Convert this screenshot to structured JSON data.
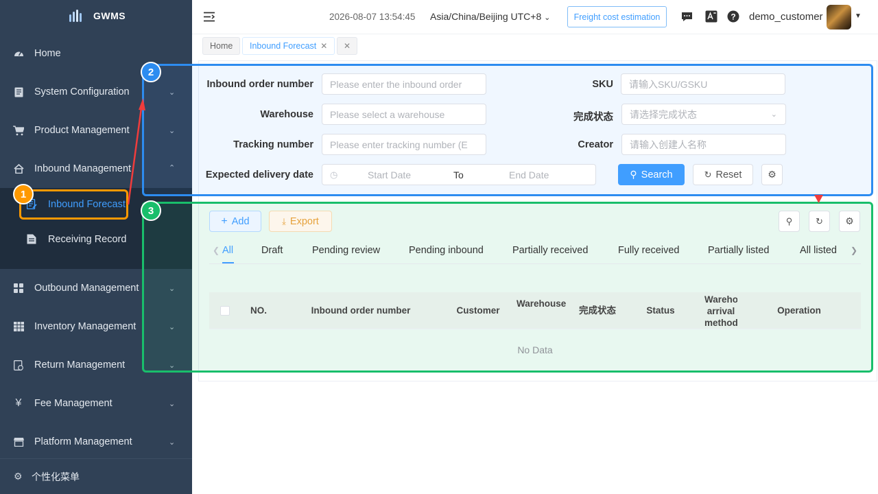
{
  "app": {
    "logo_text": "GWMS"
  },
  "sidebar": {
    "items": [
      {
        "label": "Home",
        "icon": "dashboard-icon"
      },
      {
        "label": "System Configuration",
        "icon": "document-icon"
      },
      {
        "label": "Product Management",
        "icon": "cart-icon"
      },
      {
        "label": "Inbound Management",
        "icon": "home-icon"
      },
      {
        "label": "Outbound Management",
        "icon": "grid-icon"
      },
      {
        "label": "Inventory Management",
        "icon": "table-icon"
      },
      {
        "label": "Return Management",
        "icon": "return-icon"
      },
      {
        "label": "Fee Management",
        "icon": "yen-icon"
      },
      {
        "label": "Platform Management",
        "icon": "store-icon"
      }
    ],
    "submenu": [
      {
        "label": "Inbound Forecast",
        "active": true
      },
      {
        "label": "Receiving Record",
        "active": false
      }
    ],
    "footer": "个性化菜单"
  },
  "topbar": {
    "datetime": "2026-08-07 13:54:45",
    "timezone": "Asia/China/Beijing UTC+8",
    "freight_button": "Freight cost estimation",
    "username": "demo_customer"
  },
  "tabs": [
    {
      "label": "Home"
    },
    {
      "label": "Inbound Forecast",
      "active": true
    }
  ],
  "filters": {
    "order_label": "Inbound order number",
    "order_placeholder": "Please enter the inbound order",
    "sku_label": "SKU",
    "sku_placeholder": "请输入SKU/GSKU",
    "warehouse_label": "Warehouse",
    "warehouse_placeholder": "Please select a warehouse",
    "status_label": "完成状态",
    "status_placeholder": "请选择完成状态",
    "tracking_label": "Tracking number",
    "tracking_placeholder": "Please enter tracking number (E",
    "creator_label": "Creator",
    "creator_placeholder": "请输入创建人名称",
    "date_label": "Expected delivery date",
    "start_placeholder": "Start Date",
    "to_text": "To",
    "end_placeholder": "End Date",
    "search_label": "Search",
    "reset_label": "Reset"
  },
  "toolbar": {
    "add_label": "Add",
    "export_label": "Export"
  },
  "status_tabs": [
    "All",
    "Draft",
    "Pending review",
    "Pending inbound",
    "Partially received",
    "Fully received",
    "Partially listed",
    "All listed"
  ],
  "table": {
    "columns": [
      "NO.",
      "Inbound order number",
      "Customer",
      "Warehouse",
      "完成状态",
      "Status",
      "Warehouse arrival method",
      "Operation"
    ],
    "empty_text": "No Data"
  },
  "annotations": [
    "1",
    "2",
    "3"
  ],
  "colors": {
    "sidebar": "#304156",
    "accent": "#409eff",
    "box1": "#ff9900",
    "box2": "#2d8cf0",
    "box3": "#19be6b",
    "arrow": "#f03c3c"
  }
}
